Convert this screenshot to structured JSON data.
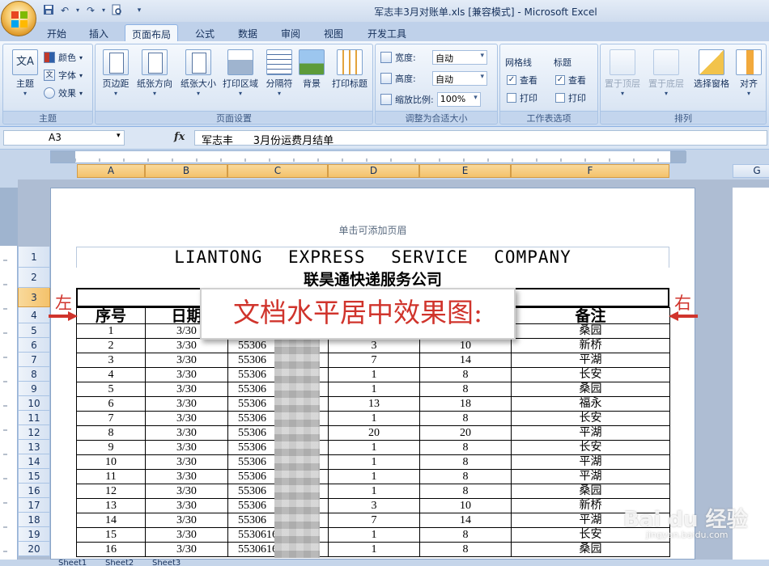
{
  "window": {
    "title": "军志丰3月对账单.xls  [兼容模式] - Microsoft Excel"
  },
  "qat": {
    "icons": [
      "save-icon",
      "undo-icon",
      "redo-icon",
      "print-preview-icon",
      "customize-icon"
    ]
  },
  "tabs": [
    "开始",
    "插入",
    "页面布局",
    "公式",
    "数据",
    "审阅",
    "视图",
    "开发工具"
  ],
  "active_tab": "页面布局",
  "ribbon": {
    "theme": {
      "title": "主题",
      "main": "主题",
      "colors": "颜色",
      "fonts": "字体",
      "effects": "效果"
    },
    "page_setup": {
      "title": "页面设置",
      "buttons": [
        "页边距",
        "纸张方向",
        "纸张大小",
        "打印区域",
        "分隔符",
        "背景",
        "打印标题"
      ]
    },
    "fit": {
      "title": "调整为合适大小",
      "width_label": "宽度:",
      "width_value": "自动",
      "height_label": "高度:",
      "height_value": "自动",
      "scale_label": "缩放比例:",
      "scale_value": "100%"
    },
    "sheet_options": {
      "title": "工作表选项",
      "gridlines": "网格线",
      "headings": "标题",
      "view": "查看",
      "print": "打印",
      "check": "✓"
    },
    "arrange": {
      "title": "排列",
      "buttons": [
        "置于顶层",
        "置于底层",
        "选择窗格",
        "对齐"
      ]
    }
  },
  "formula_bar": {
    "name_box": "A3",
    "fx": "fx",
    "content": "军志丰      3月份运费月结单"
  },
  "columns": [
    "A",
    "B",
    "C",
    "D",
    "E",
    "F",
    "G"
  ],
  "rows": [
    "1",
    "2",
    "3",
    "4",
    "5",
    "6",
    "7",
    "8",
    "9",
    "10",
    "11",
    "12",
    "13",
    "14",
    "15",
    "16",
    "17",
    "18",
    "19",
    "20"
  ],
  "page": {
    "header_hint": "单击可添加页眉"
  },
  "sheet": {
    "title_en": "LIANTONG  EXPRESS  SERVICE  COMPANY",
    "title_cn": "联昊通快递服务公司",
    "headers": [
      "序号",
      "日期",
      "",
      "",
      "",
      "备注"
    ],
    "rows": [
      [
        "1",
        "3/30",
        "",
        "",
        "",
        "桑园"
      ],
      [
        "2",
        "3/30",
        "55306",
        "3",
        "10",
        "新桥"
      ],
      [
        "3",
        "3/30",
        "55306",
        "7",
        "14",
        "平湖"
      ],
      [
        "4",
        "3/30",
        "55306",
        "1",
        "8",
        "长安"
      ],
      [
        "5",
        "3/30",
        "55306",
        "1",
        "8",
        "桑园"
      ],
      [
        "6",
        "3/30",
        "55306",
        "13",
        "18",
        "福永"
      ],
      [
        "7",
        "3/30",
        "55306",
        "1",
        "8",
        "长安"
      ],
      [
        "8",
        "3/30",
        "55306",
        "20",
        "20",
        "平湖"
      ],
      [
        "9",
        "3/30",
        "55306",
        "1",
        "8",
        "长安"
      ],
      [
        "10",
        "3/30",
        "55306",
        "1",
        "8",
        "平湖"
      ],
      [
        "11",
        "3/30",
        "55306",
        "1",
        "8",
        "平湖"
      ],
      [
        "12",
        "3/30",
        "55306",
        "1",
        "8",
        "桑园"
      ],
      [
        "13",
        "3/30",
        "55306",
        "3",
        "10",
        "新桥"
      ],
      [
        "14",
        "3/30",
        "55306",
        "7",
        "14",
        "平湖"
      ],
      [
        "15",
        "3/30",
        "553061664122",
        "1",
        "8",
        "长安"
      ],
      [
        "16",
        "3/30",
        "553061664018",
        "1",
        "8",
        "桑园"
      ]
    ]
  },
  "annotation": {
    "callout": "文档水平居中效果图:",
    "left": "左",
    "right": "右"
  },
  "sheet_tabs": [
    "Sheet1",
    "Sheet2",
    "Sheet3"
  ],
  "watermark": {
    "main": "Bai du 经验",
    "sub": "jingyan.baidu.com"
  },
  "colors": {
    "accent": "#f4c26b",
    "annotation": "#d0342c",
    "ribbon": "#dfe9f5"
  }
}
